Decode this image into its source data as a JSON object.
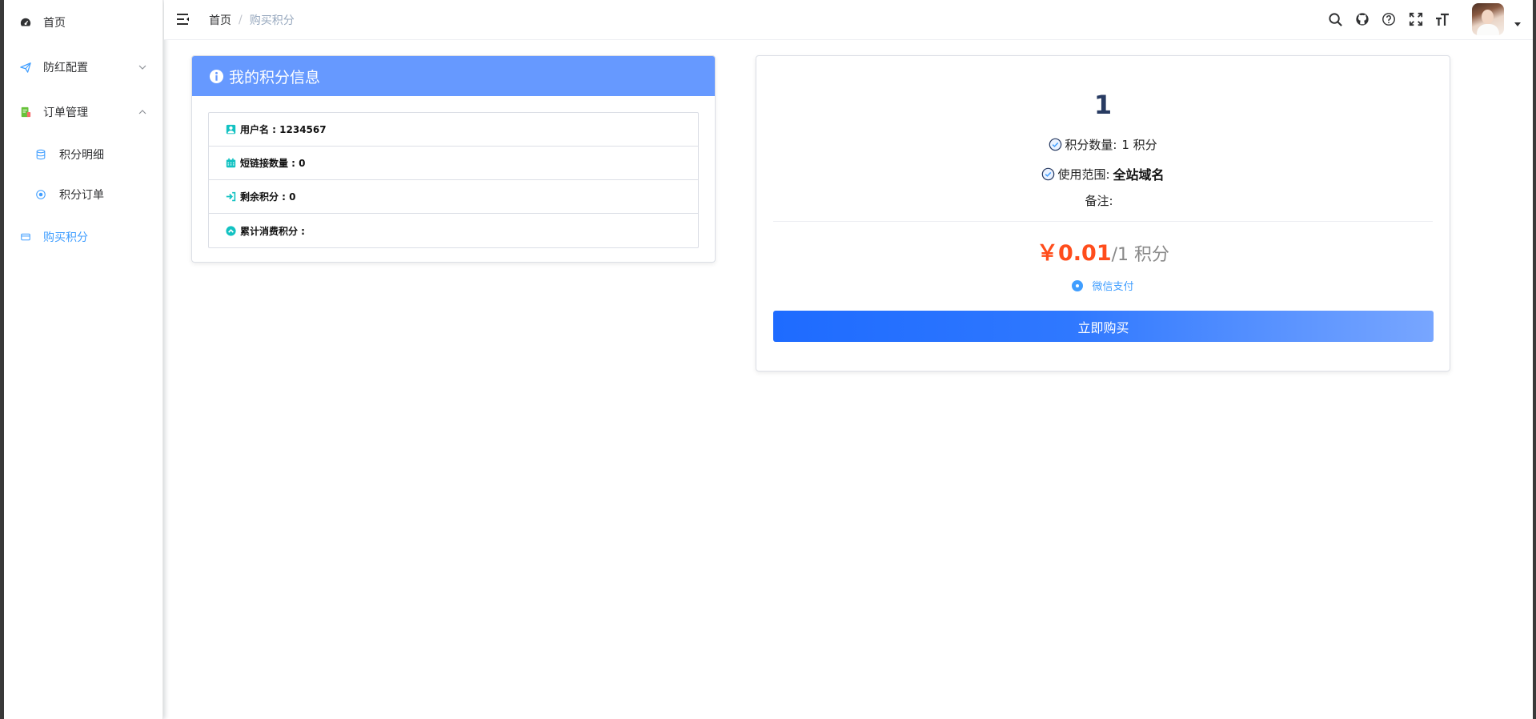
{
  "sidebar": {
    "items": [
      {
        "label": "首页",
        "icon": "dashboard-icon"
      },
      {
        "label": "防红配置",
        "icon": "paper-plane-icon"
      },
      {
        "label": "订单管理",
        "icon": "order-icon"
      },
      {
        "label": "积分明细",
        "icon": "database-icon"
      },
      {
        "label": "积分订单",
        "icon": "record-icon"
      },
      {
        "label": "购买积分",
        "icon": "purchase-icon"
      }
    ]
  },
  "header": {
    "breadcrumb": {
      "home": "首页",
      "separator": "/",
      "current": "购买积分"
    }
  },
  "info_card": {
    "title": "我的积分信息",
    "rows": [
      {
        "label": "用户名 : 1234567",
        "icon": "user-icon"
      },
      {
        "label": "短链接数量 : 0",
        "icon": "calendar-icon"
      },
      {
        "label": "剩余积分 : 0",
        "icon": "sign-in-icon"
      },
      {
        "label": "累计消费积分 :",
        "icon": "chevron-up-circle-icon"
      }
    ]
  },
  "plan_card": {
    "title": "1",
    "quantity_label": "积分数量:",
    "quantity_value": "1 积分",
    "scope_label": "使用范围:",
    "scope_value": "全站域名",
    "note_label": "备注:",
    "price": "￥0.01",
    "price_unit": "/1 积分",
    "payment_option": "微信支付",
    "buy_button": "立即购买"
  },
  "colors": {
    "accent": "#409eff",
    "card_header": "#6699ff",
    "price": "#ff4d1c",
    "button_start": "#1e6bff",
    "button_end": "#78a6ff",
    "info_icon": "#13c2c2"
  }
}
